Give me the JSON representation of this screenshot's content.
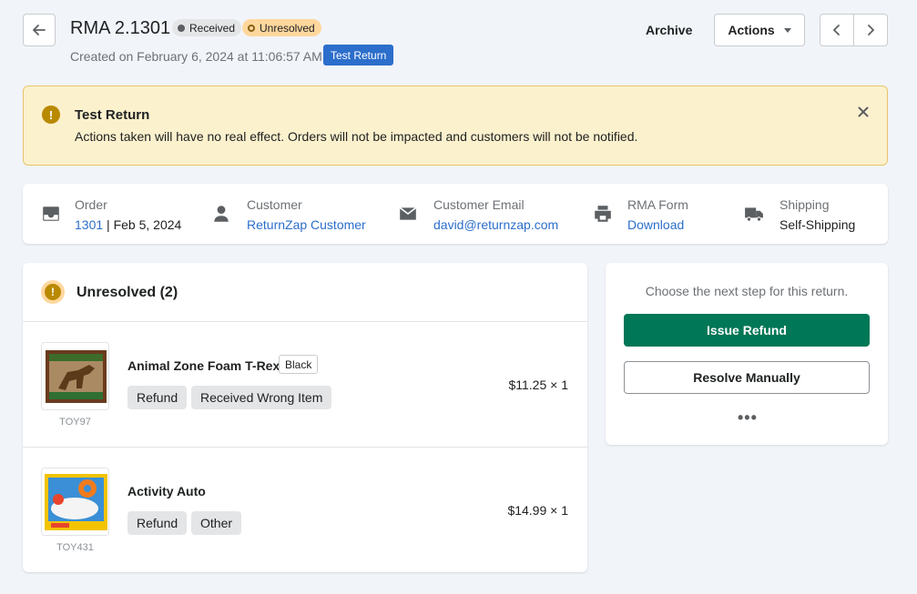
{
  "header": {
    "title": "RMA 2.1301",
    "badge_received": "Received",
    "badge_unresolved": "Unresolved",
    "created": "Created on February 6, 2024 at 11:06:57 AM",
    "test_tag": "Test Return",
    "archive_label": "Archive",
    "actions_label": "Actions"
  },
  "banner": {
    "title": "Test Return",
    "text": "Actions taken will have no real effect. Orders will not be impacted and customers will not be notified."
  },
  "info": {
    "order_label": "Order",
    "order_number": "1301",
    "order_date": " | Feb 5, 2024",
    "customer_label": "Customer",
    "customer_name": "ReturnZap Customer",
    "email_label": "Customer Email",
    "email_value": "david@returnzap.com",
    "rma_form_label": "RMA Form",
    "rma_form_link": "Download",
    "shipping_label": "Shipping",
    "shipping_value": "Self-Shipping"
  },
  "unresolved": {
    "title": "Unresolved (2)",
    "items": [
      {
        "name": "Animal Zone Foam T-Rex",
        "variant": "Black",
        "tags": [
          "Refund",
          "Received Wrong Item"
        ],
        "price": "$11.25 × 1",
        "sku": "TOY97"
      },
      {
        "name": "Activity Auto",
        "variant": "",
        "tags": [
          "Refund",
          "Other"
        ],
        "price": "$14.99 × 1",
        "sku": "TOY431"
      }
    ]
  },
  "side": {
    "prompt": "Choose the next step for this return.",
    "issue_refund": "Issue Refund",
    "resolve_manually": "Resolve Manually",
    "more": "•••"
  },
  "colors": {
    "primary_green": "#007756",
    "link_blue": "#2c6ecb",
    "warning_bg": "#fcf1cd",
    "unresolved_badge": "#ffd79d"
  }
}
